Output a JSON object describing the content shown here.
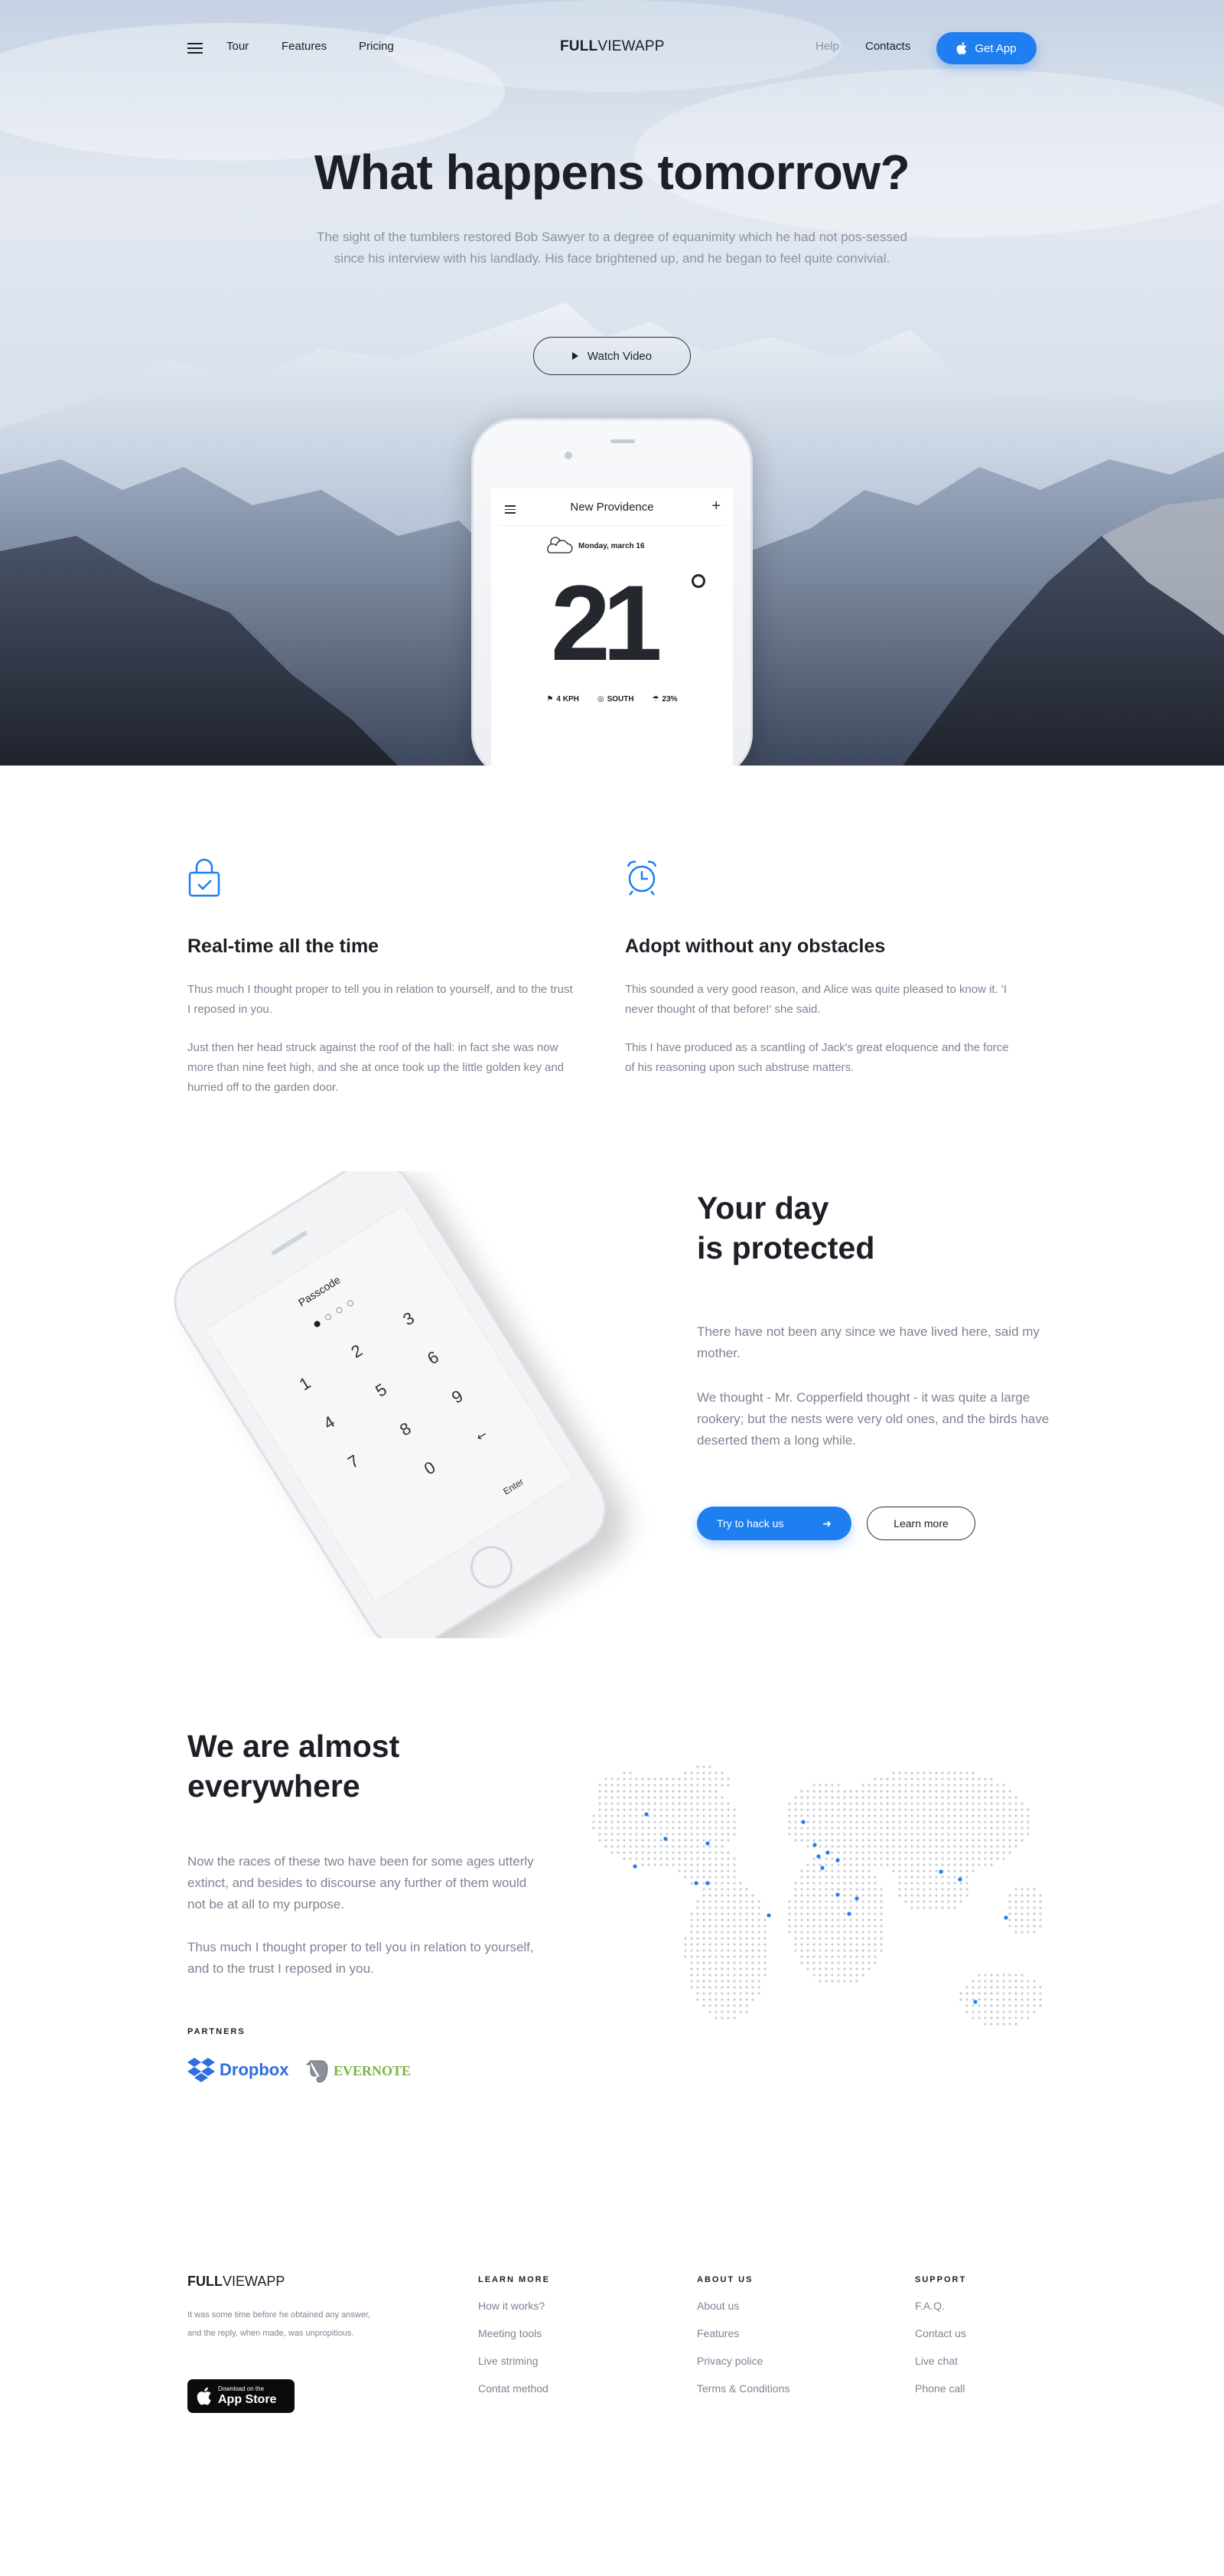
{
  "nav": {
    "links": [
      "Tour",
      "Features",
      "Pricing"
    ],
    "logo_bold": "FULL",
    "logo_light": "VIEWAPP",
    "help": "Help",
    "contacts": "Contacts",
    "get_app": "Get App"
  },
  "hero": {
    "title": "What happens tomorrow?",
    "lead": "The sight of the tumblers restored Bob Sawyer to a degree of equanimity which he had not pos-sessed since his interview with his landlady. His face brightened up, and he began to feel quite convivial.",
    "watch_video": "Watch Video",
    "phone": {
      "city": "New Providence",
      "date": "Monday, march 16",
      "temperature": "21",
      "wind": "4 KPH",
      "direction": "SOUTH",
      "humidity": "23%"
    }
  },
  "features": [
    {
      "icon": "lock-check-icon",
      "title": "Real-time all the time",
      "paragraphs": [
        "Thus much I thought proper to tell you in relation to yourself, and to the trust I reposed in you.",
        "Just then her head struck against the roof of the hall: in fact she was now more than nine feet high, and she at once took up the little golden key and hurried off to the garden door."
      ]
    },
    {
      "icon": "alarm-clock-icon",
      "title": "Adopt without any obstacles",
      "paragraphs": [
        "This sounded a very good reason, and Alice was quite pleased to know it. 'I never thought of that before!' she said.",
        "This I have produced as a scantling of Jack's great eloquence and the force of his reasoning upon such abstruse matters."
      ]
    }
  ],
  "passcode_phone": {
    "title": "Passcode",
    "keys": [
      "1",
      "2",
      "3",
      "4",
      "5",
      "6",
      "7",
      "8",
      "9",
      "0"
    ],
    "enter": "Enter"
  },
  "protected": {
    "title_line1": "Your day",
    "title_line2": "is protected",
    "paragraphs": [
      "There have not been any since we have lived here, said my mother.",
      "We thought - Mr. Copperfield thought - it was quite a large rookery; but the nests were very old ones, and the birds have deserted them a long while."
    ],
    "primary_button": "Try to hack us",
    "secondary_button": "Learn more"
  },
  "everywhere": {
    "title_line1": "We are almost",
    "title_line2": "everywhere",
    "paragraphs": [
      "Now the races of these two have been for some ages utterly extinct, and besides to discourse any further of them would not be at all to my purpose.",
      "Thus much I thought proper to tell you in relation to yourself, and to the trust I reposed in you."
    ],
    "partners_label": "PARTNERS",
    "partners": [
      "Dropbox",
      "EVERNOTE"
    ]
  },
  "footer": {
    "logo_bold": "FULL",
    "logo_light": "VIEWAPP",
    "description": "It was some time before he obtained any answer, and the reply, when made, was unpropitious.",
    "appstore_small": "Download on the",
    "appstore_big": "App Store",
    "columns": [
      {
        "heading": "LEARN MORE",
        "links": [
          "How it works?",
          "Meeting tools",
          "Live striming",
          "Contat method"
        ]
      },
      {
        "heading": "ABOUT US",
        "links": [
          "About us",
          "Features",
          "Privacy police",
          "Terms & Conditions"
        ]
      },
      {
        "heading": "SUPPORT",
        "links": [
          "F.A.Q.",
          "Contact us",
          "Live chat",
          "Phone call"
        ]
      }
    ]
  },
  "colors": {
    "accent": "#1f7ff0",
    "text": "#1c1f26",
    "muted": "#7c8494",
    "dropbox": "#2f6de0",
    "evernote": "#7cb342"
  }
}
